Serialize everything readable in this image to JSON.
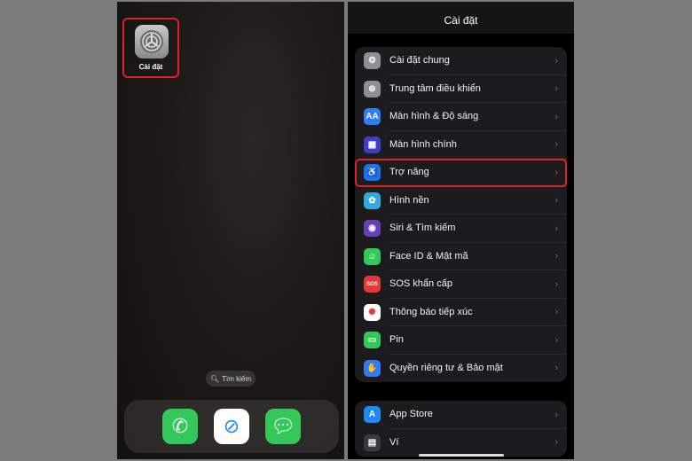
{
  "home": {
    "settings_app_label": "Cài đặt",
    "search_label": "Tìm kiếm",
    "dock": [
      {
        "icon": "phone-icon",
        "color": "#34c759"
      },
      {
        "icon": "safari-icon",
        "color": "#ffffff"
      },
      {
        "icon": "messages-icon",
        "color": "#34c759"
      }
    ]
  },
  "settings": {
    "title": "Cài đặt",
    "group1": [
      {
        "label": "Cài đặt chung",
        "icon": "gear-icon",
        "color": "#8e8e93",
        "glyph": "⚙"
      },
      {
        "label": "Trung tâm điều khiển",
        "icon": "toggles-icon",
        "color": "#8e8e93",
        "glyph": "⊜"
      },
      {
        "label": "Màn hình & Độ sáng",
        "icon": "text-size-icon",
        "color": "#2f7cf6",
        "glyph": "AA"
      },
      {
        "label": "Màn hình chính",
        "icon": "home-screen-icon",
        "color": "#3a3fc4",
        "glyph": "▦"
      },
      {
        "label": "Trợ năng",
        "icon": "accessibility-icon",
        "color": "#1a73e8",
        "glyph": "♿",
        "highlighted": true
      },
      {
        "label": "Hình nền",
        "icon": "wallpaper-icon",
        "color": "#34aadc",
        "glyph": "✿"
      },
      {
        "label": "Siri & Tìm kiếm",
        "icon": "siri-icon",
        "color": "#6a3fb5",
        "glyph": "◉"
      },
      {
        "label": "Face ID & Mật mã",
        "icon": "face-id-icon",
        "color": "#34c759",
        "glyph": "☺"
      },
      {
        "label": "SOS khẩn cấp",
        "icon": "sos-icon",
        "color": "#e53935",
        "glyph": "SOS"
      },
      {
        "label": "Thông báo tiếp xúc",
        "icon": "exposure-icon",
        "color": "#ffffff",
        "glyph": "✺"
      },
      {
        "label": "Pin",
        "icon": "battery-icon",
        "color": "#34c759",
        "glyph": "▭"
      },
      {
        "label": "Quyền riêng tư & Bảo mật",
        "icon": "hand-icon",
        "color": "#3478f6",
        "glyph": "✋"
      }
    ],
    "group2": [
      {
        "label": "App Store",
        "icon": "app-store-icon",
        "color": "#1e88f5",
        "glyph": "A"
      },
      {
        "label": "Ví",
        "icon": "wallet-icon",
        "color": "#3a3a3c",
        "glyph": "▤"
      }
    ]
  }
}
